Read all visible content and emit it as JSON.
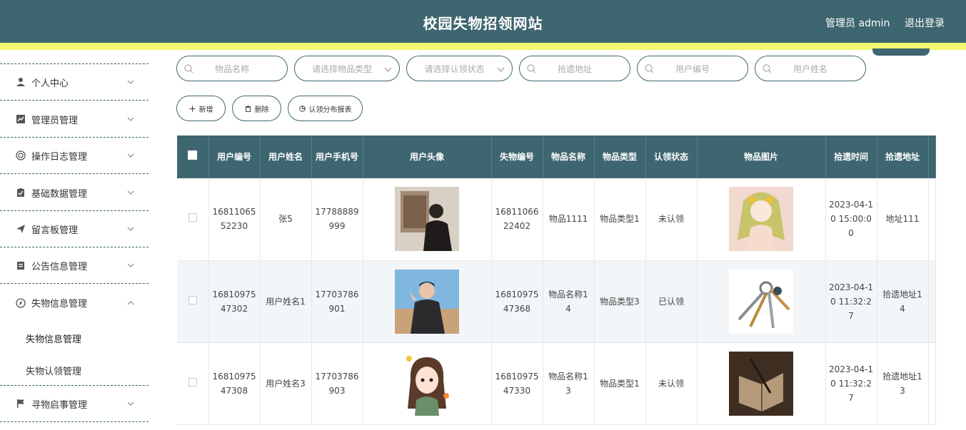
{
  "header": {
    "title": "校园失物招领网站",
    "user_label": "管理员 admin",
    "logout_label": "退出登录"
  },
  "sidebar": {
    "items": [
      {
        "label": "个人中心",
        "icon": "user-icon"
      },
      {
        "label": "管理员管理",
        "icon": "chart-icon"
      },
      {
        "label": "操作日志管理",
        "icon": "target-icon"
      },
      {
        "label": "基础数据管理",
        "icon": "clipboard-check-icon"
      },
      {
        "label": "留言板管理",
        "icon": "send-icon"
      },
      {
        "label": "公告信息管理",
        "icon": "notice-icon"
      },
      {
        "label": "失物信息管理",
        "icon": "compass-icon"
      },
      {
        "label": "寻物启事管理",
        "icon": "flag-icon"
      }
    ],
    "sub_items": [
      {
        "label": "失物信息管理"
      },
      {
        "label": "失物认领管理"
      }
    ]
  },
  "search": {
    "item_name": "物品名称",
    "item_type": "请选择物品类型",
    "claim_status": "请选择认领状态",
    "pickup_address": "拾遗地址",
    "user_number": "用户编号",
    "user_name": "用户姓名"
  },
  "actions": {
    "add": "新增",
    "delete": "删除",
    "report": "认领分布报表"
  },
  "table": {
    "headers": [
      "用户编号",
      "用户姓名",
      "用户手机号",
      "用户头像",
      "失物编号",
      "物品名称",
      "物品类型",
      "认领状态",
      "物品图片",
      "拾遗时间",
      "拾遗地址"
    ],
    "rows": [
      {
        "user_number": "1681106552230",
        "user_name": "张5",
        "phone": "17788889999",
        "avatar": "avatar-photo-1",
        "item_number": "1681106622402",
        "item_name": "物品1111",
        "item_type": "物品类型1",
        "status": "未认领",
        "item_image": "anime-girl-image",
        "time": "2023-04-10 15:00:00",
        "address": "地址111"
      },
      {
        "user_number": "1681097547302",
        "user_name": "用户姓名1",
        "phone": "17703786901",
        "avatar": "avatar-photo-2",
        "item_number": "1681097547368",
        "item_name": "物品名称14",
        "item_type": "物品类型3",
        "status": "已认领",
        "item_image": "keys-image",
        "time": "2023-04-10 11:32:27",
        "address": "拾遗地址14"
      },
      {
        "user_number": "1681097547308",
        "user_name": "用户姓名3",
        "phone": "17703786903",
        "avatar": "avatar-cartoon-3",
        "item_number": "1681097547330",
        "item_name": "物品名称13",
        "item_type": "物品类型1",
        "status": "未认领",
        "item_image": "book-image",
        "time": "2023-04-10 11:32:27",
        "address": "拾遗地址13"
      }
    ]
  },
  "colors": {
    "primary": "#3e6670",
    "accent_bar": "#f2f76f"
  }
}
